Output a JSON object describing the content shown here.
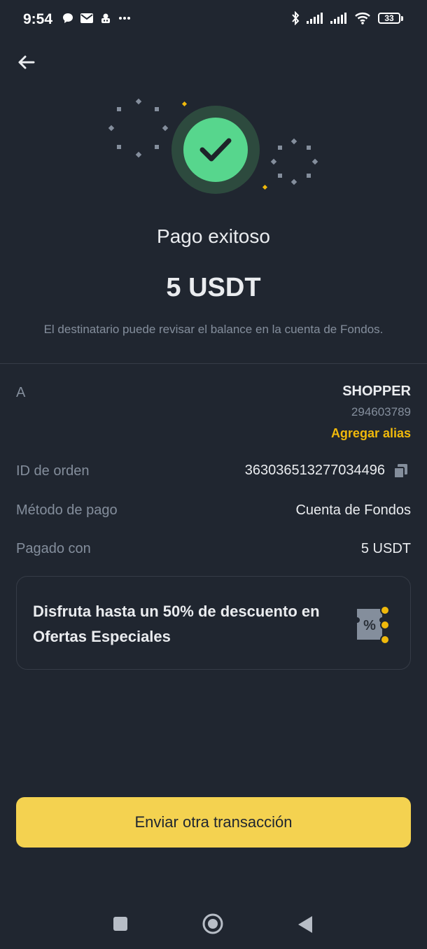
{
  "status_bar": {
    "time": "9:54",
    "battery": "33",
    "left_icons": [
      "chat-icon",
      "mail-icon",
      "app-icon",
      "more-icon"
    ],
    "right_icons": [
      "bluetooth-icon",
      "signal-icon",
      "signal-icon",
      "wifi-icon",
      "battery-icon"
    ]
  },
  "header": {
    "back_icon": "arrow-left-icon"
  },
  "result": {
    "icon": "check-circle-icon",
    "title": "Pago exitoso",
    "amount": "5 USDT",
    "subtitle": "El destinatario puede revisar el balance en la cuenta de Fondos.",
    "accent_color": "#57D68D"
  },
  "details": {
    "to_label": "A",
    "recipient_name": "SHOPPER",
    "recipient_id": "294603789",
    "add_alias": "Agregar alias",
    "order_label": "ID de orden",
    "order_id": "363036513277034496",
    "method_label": "Método de pago",
    "method_value": "Cuenta de Fondos",
    "paid_label": "Pagado con",
    "paid_value": "5 USDT"
  },
  "promo": {
    "text": "Disfruta hasta un 50% de descuento en Ofertas Especiales",
    "icon": "discount-coupon-icon"
  },
  "cta": {
    "label": "Enviar otra transacción",
    "color": "#F4D250"
  },
  "nav": {
    "icons": [
      "square-icon",
      "home-circle-icon",
      "back-triangle-icon"
    ]
  }
}
